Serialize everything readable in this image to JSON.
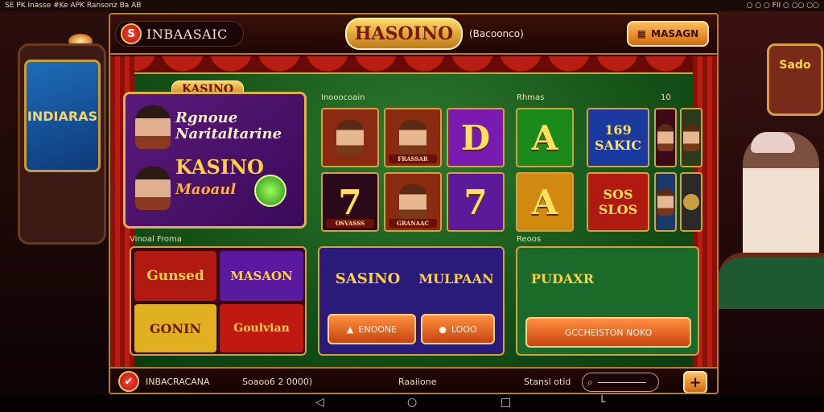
{
  "status_bar": {
    "left": "SE  PK  Inasse  #Ke  APK  Ransonz  Ba  AB",
    "right": "○  ○  ○  FII  ○  ○○  ○○"
  },
  "background": {
    "left_screen_text": "INDIARAS",
    "right_slot_text": "Sado"
  },
  "header": {
    "brand_chip": "S",
    "brand_text": "INBAASAIC",
    "logo": "HASOINO",
    "subtitle": "(Bacoonco)",
    "login_label": "MASAGN"
  },
  "hero": {
    "tab": "KASINO",
    "line1": "Rgnoue",
    "line2": "Naritaltarine",
    "line3": "KASINO",
    "line4": "Maoaul"
  },
  "sections": {
    "popular_label": "Inooocoain",
    "right_label": "Rhmas",
    "right_count": "10̀",
    "left_bottom_label": "Vinoal Froma",
    "right_bottom_label": "Reoos"
  },
  "tiles": [
    {
      "kind": "face",
      "caption": ""
    },
    {
      "kind": "face",
      "caption": "FRASSAR"
    },
    {
      "kind": "text",
      "text": "D",
      "bg": "#7a1ab0"
    },
    {
      "kind": "text",
      "text": "A",
      "bg": "#1a8a1a"
    },
    {
      "kind": "text",
      "text": "169 SAKIC",
      "bg": "#1a3aa0"
    },
    {
      "kind": "text",
      "text": "7",
      "bg": "#2a0a1a",
      "caption": "OSVASSS"
    },
    {
      "kind": "face",
      "caption": "GRANAAC"
    },
    {
      "kind": "text",
      "text": "7",
      "bg": "#5a1a9a"
    },
    {
      "kind": "text",
      "text": "A",
      "bg": "#d08a10"
    },
    {
      "kind": "text",
      "text": "SOS SLOS",
      "bg": "#b01a10"
    }
  ],
  "promos": {
    "p1": "Gunsed",
    "p2": "MASAON",
    "p3": "GONIN",
    "p4": "Goulvian",
    "p5": "SASINO",
    "p6": "MULPAAN",
    "p7": "PUDAXR"
  },
  "actions": {
    "a1": "ENOONE",
    "a2": "LOOO",
    "a3": "GCCHEISTON  NOKO"
  },
  "bottom": {
    "brand": "INBACRACANA",
    "mid": "Soaoo6  2 0000)",
    "center": "Raaiione",
    "right": "Stansl otid",
    "search_icon": "⌕",
    "plus": "+"
  },
  "nav": {
    "back": "◁",
    "home": "○",
    "recent": "□",
    "extra": "└"
  }
}
